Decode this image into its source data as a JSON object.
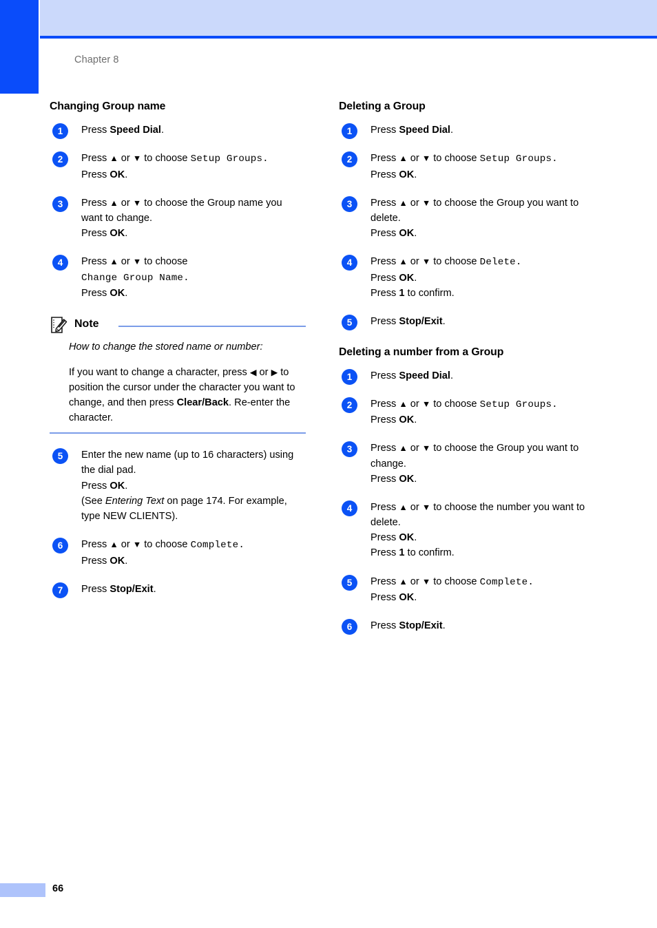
{
  "page": {
    "chapter_label": "Chapter 8",
    "page_number": "66",
    "accent_dark_blue": "#0a4cfa",
    "accent_light_blue": "#cbd9fb",
    "footer_bar_color": "#aec3fb",
    "note_rule_color": "#7b9ce8",
    "bullet_color": "#0b52f5"
  },
  "left_column": {
    "section1": {
      "heading": "Changing Group name",
      "steps": [
        {
          "num": "1",
          "lines": [
            {
              "parts": [
                {
                  "t": "Press ",
                  "s": "n"
                },
                {
                  "t": "Speed Dial",
                  "s": "b"
                },
                {
                  "t": ".",
                  "s": "n"
                }
              ]
            }
          ]
        },
        {
          "num": "2",
          "lines": [
            {
              "parts": [
                {
                  "t": "Press ",
                  "s": "n"
                },
                {
                  "t": "▲",
                  "s": "a"
                },
                {
                  "t": " or ",
                  "s": "n"
                },
                {
                  "t": "▼",
                  "s": "a"
                },
                {
                  "t": " to choose ",
                  "s": "n"
                },
                {
                  "t": "Setup Groups.",
                  "s": "m"
                }
              ]
            },
            {
              "parts": [
                {
                  "t": "Press ",
                  "s": "n"
                },
                {
                  "t": "OK",
                  "s": "b"
                },
                {
                  "t": ".",
                  "s": "n"
                }
              ]
            }
          ]
        },
        {
          "num": "3",
          "lines": [
            {
              "parts": [
                {
                  "t": "Press ",
                  "s": "n"
                },
                {
                  "t": "▲",
                  "s": "a"
                },
                {
                  "t": " or ",
                  "s": "n"
                },
                {
                  "t": "▼",
                  "s": "a"
                },
                {
                  "t": " to choose the Group name you want to change.",
                  "s": "n"
                }
              ]
            },
            {
              "parts": [
                {
                  "t": "Press ",
                  "s": "n"
                },
                {
                  "t": "OK",
                  "s": "b"
                },
                {
                  "t": ".",
                  "s": "n"
                }
              ]
            }
          ]
        },
        {
          "num": "4",
          "lines": [
            {
              "parts": [
                {
                  "t": "Press ",
                  "s": "n"
                },
                {
                  "t": "▲",
                  "s": "a"
                },
                {
                  "t": " or ",
                  "s": "n"
                },
                {
                  "t": "▼",
                  "s": "a"
                },
                {
                  "t": " to choose",
                  "s": "n"
                }
              ]
            },
            {
              "parts": [
                {
                  "t": "Change Group Name.",
                  "s": "m"
                }
              ]
            },
            {
              "parts": [
                {
                  "t": "Press ",
                  "s": "n"
                },
                {
                  "t": "OK",
                  "s": "b"
                },
                {
                  "t": ".",
                  "s": "n"
                }
              ]
            }
          ]
        }
      ],
      "note": {
        "title": "Note",
        "icon": "notepad-pencil-icon",
        "paragraphs": [
          {
            "parts": [
              {
                "t": "How to change the stored name or number:",
                "s": "i"
              }
            ]
          },
          {
            "parts": [
              {
                "t": "If you want to change a character, press ",
                "s": "n"
              },
              {
                "t": "◀",
                "s": "a"
              },
              {
                "t": " or ",
                "s": "n"
              },
              {
                "t": "▶",
                "s": "a"
              },
              {
                "t": " to position the cursor under the character you want to change, and then press ",
                "s": "n"
              },
              {
                "t": "Clear/Back",
                "s": "b"
              },
              {
                "t": ". Re-enter the character.",
                "s": "n"
              }
            ]
          }
        ]
      },
      "steps_after_note": [
        {
          "num": "5",
          "lines": [
            {
              "parts": [
                {
                  "t": "Enter the new name (up to 16 characters) using the dial pad.",
                  "s": "n"
                }
              ]
            },
            {
              "parts": [
                {
                  "t": "Press ",
                  "s": "n"
                },
                {
                  "t": "OK",
                  "s": "b"
                },
                {
                  "t": ".",
                  "s": "n"
                }
              ]
            },
            {
              "parts": [
                {
                  "t": "(See ",
                  "s": "n"
                },
                {
                  "t": "Entering Text",
                  "s": "i"
                },
                {
                  "t": " on page 174. For example, type NEW CLIENTS).",
                  "s": "n"
                }
              ]
            }
          ]
        },
        {
          "num": "6",
          "lines": [
            {
              "parts": [
                {
                  "t": "Press ",
                  "s": "n"
                },
                {
                  "t": "▲",
                  "s": "a"
                },
                {
                  "t": " or ",
                  "s": "n"
                },
                {
                  "t": "▼",
                  "s": "a"
                },
                {
                  "t": " to choose ",
                  "s": "n"
                },
                {
                  "t": "Complete.",
                  "s": "m"
                }
              ]
            },
            {
              "parts": [
                {
                  "t": "Press ",
                  "s": "n"
                },
                {
                  "t": "OK",
                  "s": "b"
                },
                {
                  "t": ".",
                  "s": "n"
                }
              ]
            }
          ]
        },
        {
          "num": "7",
          "lines": [
            {
              "parts": [
                {
                  "t": "Press ",
                  "s": "n"
                },
                {
                  "t": "Stop/Exit",
                  "s": "b"
                },
                {
                  "t": ".",
                  "s": "n"
                }
              ]
            }
          ]
        }
      ]
    }
  },
  "right_column": {
    "section1": {
      "heading": "Deleting a Group",
      "steps": [
        {
          "num": "1",
          "lines": [
            {
              "parts": [
                {
                  "t": "Press ",
                  "s": "n"
                },
                {
                  "t": "Speed Dial",
                  "s": "b"
                },
                {
                  "t": ".",
                  "s": "n"
                }
              ]
            }
          ]
        },
        {
          "num": "2",
          "lines": [
            {
              "parts": [
                {
                  "t": "Press ",
                  "s": "n"
                },
                {
                  "t": "▲",
                  "s": "a"
                },
                {
                  "t": " or ",
                  "s": "n"
                },
                {
                  "t": "▼",
                  "s": "a"
                },
                {
                  "t": " to choose ",
                  "s": "n"
                },
                {
                  "t": "Setup Groups.",
                  "s": "m"
                }
              ]
            },
            {
              "parts": [
                {
                  "t": "Press ",
                  "s": "n"
                },
                {
                  "t": "OK",
                  "s": "b"
                },
                {
                  "t": ".",
                  "s": "n"
                }
              ]
            }
          ]
        },
        {
          "num": "3",
          "lines": [
            {
              "parts": [
                {
                  "t": "Press ",
                  "s": "n"
                },
                {
                  "t": "▲",
                  "s": "a"
                },
                {
                  "t": " or ",
                  "s": "n"
                },
                {
                  "t": "▼",
                  "s": "a"
                },
                {
                  "t": " to choose the Group you want to delete.",
                  "s": "n"
                }
              ]
            },
            {
              "parts": [
                {
                  "t": "Press ",
                  "s": "n"
                },
                {
                  "t": "OK",
                  "s": "b"
                },
                {
                  "t": ".",
                  "s": "n"
                }
              ]
            }
          ]
        },
        {
          "num": "4",
          "lines": [
            {
              "parts": [
                {
                  "t": "Press ",
                  "s": "n"
                },
                {
                  "t": "▲",
                  "s": "a"
                },
                {
                  "t": " or ",
                  "s": "n"
                },
                {
                  "t": "▼",
                  "s": "a"
                },
                {
                  "t": " to choose ",
                  "s": "n"
                },
                {
                  "t": "Delete.",
                  "s": "m"
                }
              ]
            },
            {
              "parts": [
                {
                  "t": "Press ",
                  "s": "n"
                },
                {
                  "t": "OK",
                  "s": "b"
                },
                {
                  "t": ".",
                  "s": "n"
                }
              ]
            },
            {
              "parts": [
                {
                  "t": "Press ",
                  "s": "n"
                },
                {
                  "t": "1",
                  "s": "b"
                },
                {
                  "t": " to confirm.",
                  "s": "n"
                }
              ]
            }
          ]
        },
        {
          "num": "5",
          "lines": [
            {
              "parts": [
                {
                  "t": "Press ",
                  "s": "n"
                },
                {
                  "t": "Stop/Exit",
                  "s": "b"
                },
                {
                  "t": ".",
                  "s": "n"
                }
              ]
            }
          ]
        }
      ]
    },
    "section2": {
      "heading": "Deleting a number from a Group",
      "steps": [
        {
          "num": "1",
          "lines": [
            {
              "parts": [
                {
                  "t": "Press ",
                  "s": "n"
                },
                {
                  "t": "Speed Dial",
                  "s": "b"
                },
                {
                  "t": ".",
                  "s": "n"
                }
              ]
            }
          ]
        },
        {
          "num": "2",
          "lines": [
            {
              "parts": [
                {
                  "t": "Press ",
                  "s": "n"
                },
                {
                  "t": "▲",
                  "s": "a"
                },
                {
                  "t": " or ",
                  "s": "n"
                },
                {
                  "t": "▼",
                  "s": "a"
                },
                {
                  "t": " to choose ",
                  "s": "n"
                },
                {
                  "t": "Setup Groups.",
                  "s": "m"
                }
              ]
            },
            {
              "parts": [
                {
                  "t": "Press ",
                  "s": "n"
                },
                {
                  "t": "OK",
                  "s": "b"
                },
                {
                  "t": ".",
                  "s": "n"
                }
              ]
            }
          ]
        },
        {
          "num": "3",
          "lines": [
            {
              "parts": [
                {
                  "t": "Press ",
                  "s": "n"
                },
                {
                  "t": "▲",
                  "s": "a"
                },
                {
                  "t": " or ",
                  "s": "n"
                },
                {
                  "t": "▼",
                  "s": "a"
                },
                {
                  "t": " to choose the Group you want to change.",
                  "s": "n"
                }
              ]
            },
            {
              "parts": [
                {
                  "t": "Press ",
                  "s": "n"
                },
                {
                  "t": "OK",
                  "s": "b"
                },
                {
                  "t": ".",
                  "s": "n"
                }
              ]
            }
          ]
        },
        {
          "num": "4",
          "lines": [
            {
              "parts": [
                {
                  "t": "Press ",
                  "s": "n"
                },
                {
                  "t": "▲",
                  "s": "a"
                },
                {
                  "t": " or ",
                  "s": "n"
                },
                {
                  "t": "▼",
                  "s": "a"
                },
                {
                  "t": " to choose the number you want to delete.",
                  "s": "n"
                }
              ]
            },
            {
              "parts": [
                {
                  "t": "Press ",
                  "s": "n"
                },
                {
                  "t": "OK",
                  "s": "b"
                },
                {
                  "t": ".",
                  "s": "n"
                }
              ]
            },
            {
              "parts": [
                {
                  "t": "Press ",
                  "s": "n"
                },
                {
                  "t": "1",
                  "s": "b"
                },
                {
                  "t": " to confirm.",
                  "s": "n"
                }
              ]
            }
          ]
        },
        {
          "num": "5",
          "lines": [
            {
              "parts": [
                {
                  "t": "Press ",
                  "s": "n"
                },
                {
                  "t": "▲",
                  "s": "a"
                },
                {
                  "t": " or ",
                  "s": "n"
                },
                {
                  "t": "▼",
                  "s": "a"
                },
                {
                  "t": " to choose ",
                  "s": "n"
                },
                {
                  "t": "Complete.",
                  "s": "m"
                }
              ]
            },
            {
              "parts": [
                {
                  "t": "Press ",
                  "s": "n"
                },
                {
                  "t": "OK",
                  "s": "b"
                },
                {
                  "t": ".",
                  "s": "n"
                }
              ]
            }
          ]
        },
        {
          "num": "6",
          "lines": [
            {
              "parts": [
                {
                  "t": "Press ",
                  "s": "n"
                },
                {
                  "t": "Stop/Exit",
                  "s": "b"
                },
                {
                  "t": ".",
                  "s": "n"
                }
              ]
            }
          ]
        }
      ]
    }
  }
}
